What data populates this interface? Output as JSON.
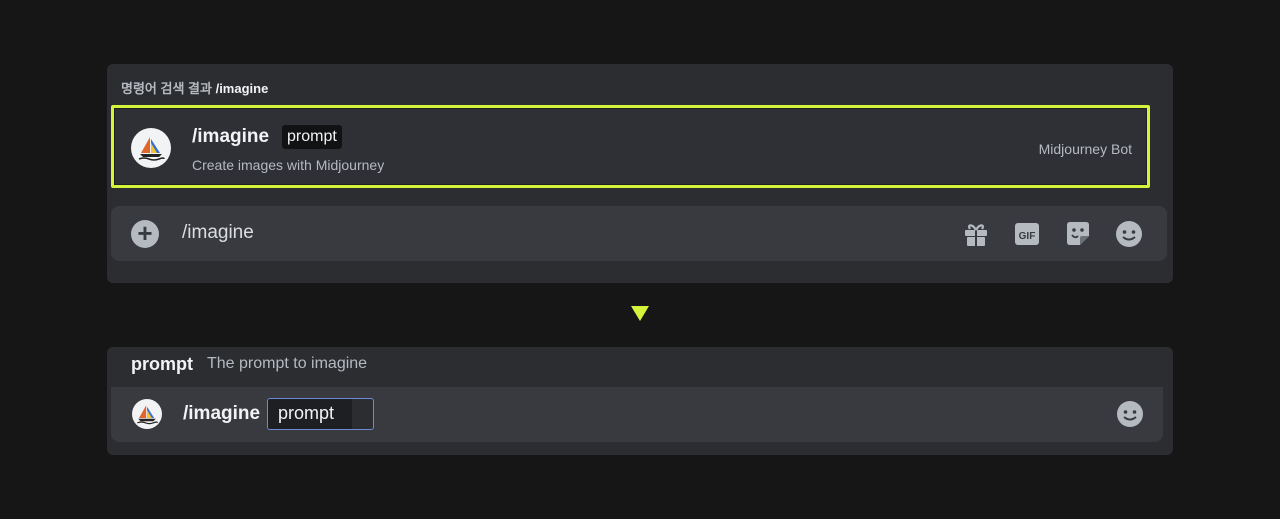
{
  "search": {
    "header_prefix": "명령어 검색 결과",
    "header_cmd": "/imagine"
  },
  "result": {
    "command": "/imagine",
    "option": "prompt",
    "description": "Create images with Midjourney",
    "bot": "Midjourney Bot"
  },
  "input": {
    "text": "/imagine",
    "icons": [
      "plus-icon",
      "gift-icon",
      "gif-icon",
      "sticker-icon",
      "emoji-icon"
    ],
    "gif_label": "GIF"
  },
  "option_help": {
    "name": "prompt",
    "description": "The prompt to imagine"
  },
  "input2": {
    "command": "/imagine",
    "option_value": "prompt"
  },
  "colors": {
    "highlight": "#d6f33c",
    "arrow": "#d6f33c"
  }
}
